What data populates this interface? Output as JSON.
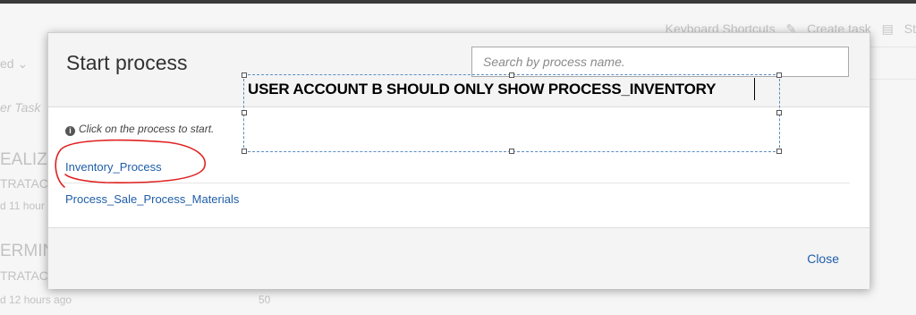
{
  "background": {
    "header_actions": [
      "Keyboard Shortcuts",
      "Create task",
      "St"
    ],
    "filter_label": "ed",
    "filter_hint": "er Task",
    "items": [
      {
        "title": "EALIZA",
        "subtitle": "TRATACI",
        "meta": "d 11 hour"
      },
      {
        "title": "ERMING",
        "subtitle": "TRATACI",
        "meta": "d 12 hours ago",
        "count": "50"
      }
    ]
  },
  "modal": {
    "title": "Start process",
    "search_placeholder": "Search by process name.",
    "hint": "Click on the process to start.",
    "processes": [
      "Inventory_Process",
      "Process_Sale_Process_Materials"
    ],
    "close_label": "Close"
  },
  "annotation": {
    "text": "USER ACCOUNT B SHOULD ONLY SHOW PROCESS_INVENTORY",
    "circle_color": "#e02020"
  }
}
